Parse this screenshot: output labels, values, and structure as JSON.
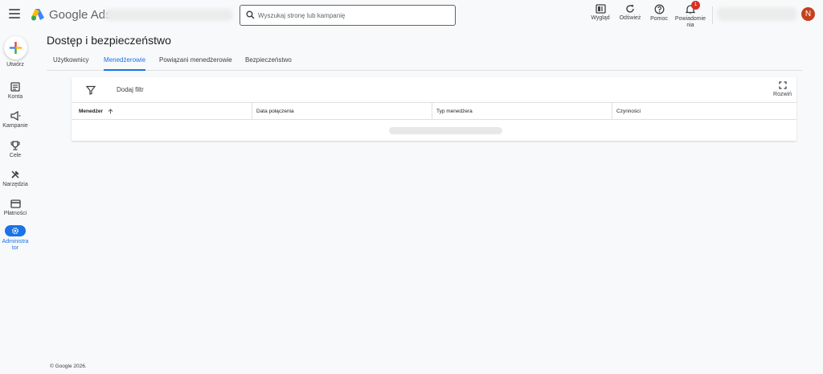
{
  "header": {
    "brand": "Google Ads",
    "search_placeholder": "Wyszukaj stronę lub kampanię",
    "actions": {
      "appearance": "Wygląd",
      "refresh": "Odśwież",
      "help": "Pomoc",
      "notifications_line1": "Powiadomie",
      "notifications_line2": "nia",
      "notifications_count": "1"
    },
    "avatar_initial": "N"
  },
  "nav": {
    "create": "Utwórz",
    "accounts": "Konta",
    "campaigns": "Kampanie",
    "goals": "Cele",
    "tools": "Narzędzia",
    "billing": "Płatności",
    "admin_line1": "Administra",
    "admin_line2": "tor"
  },
  "page": {
    "title": "Dostęp i bezpieczeństwo",
    "tabs": [
      "Użytkownicy",
      "Menedżerowie",
      "Powiązani menedżerowie",
      "Bezpieczeństwo"
    ],
    "active_tab": "Menedżerowie"
  },
  "table": {
    "add_filter": "Dodaj filtr",
    "expand_label": "Rozwiń",
    "columns": [
      "Menedżer",
      "Data połączenia",
      "Typ menedżera",
      "Czynności"
    ]
  },
  "footer": "© Google 2026.",
  "colors": {
    "accent": "#1a73e8",
    "avatar": "#c5401f",
    "badge": "#d93025"
  }
}
